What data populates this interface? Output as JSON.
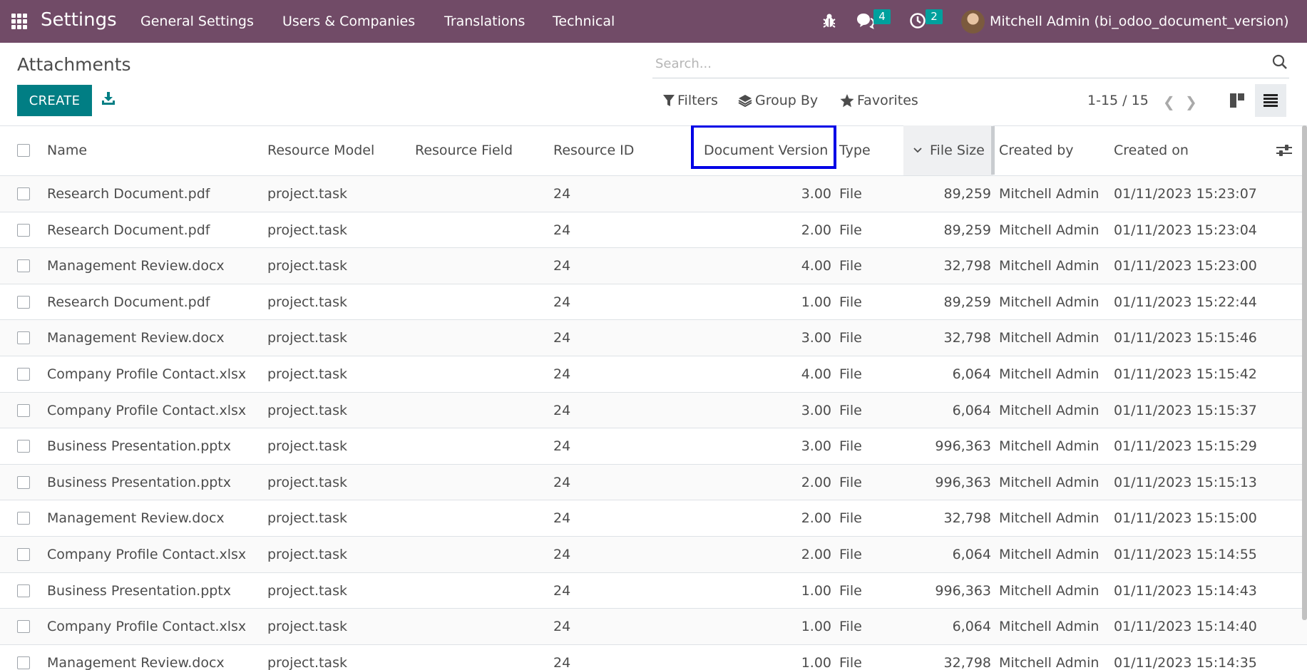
{
  "navbar": {
    "app_name": "Settings",
    "menus": [
      "General Settings",
      "Users & Companies",
      "Translations",
      "Technical"
    ],
    "messages_count": "4",
    "activities_count": "2",
    "user_name": "Mitchell Admin (bi_odoo_document_version)",
    "bg_color": "#714b67",
    "badge_color": "#00a09d"
  },
  "control_panel": {
    "title": "Attachments",
    "create_label": "CREATE",
    "search_placeholder": "Search...",
    "filters_label": "Filters",
    "group_by_label": "Group By",
    "favorites_label": "Favorites",
    "pager": "1-15 / 15",
    "accent_color": "#017e84"
  },
  "table": {
    "columns": [
      "Name",
      "Resource Model",
      "Resource Field",
      "Resource ID",
      "Document Version",
      "Type",
      "File Size",
      "Created by",
      "Created on"
    ],
    "highlighted_column": "Document Version",
    "highlight_color": "#0000e6",
    "sorted_column": "File Size",
    "rows": [
      {
        "name": "Research Document.pdf",
        "model": "project.task",
        "field": "",
        "res_id": "24",
        "version": "3.00",
        "type": "File",
        "size": "89,259",
        "created_by": "Mitchell Admin",
        "created_on": "01/11/2023 15:23:07"
      },
      {
        "name": "Research Document.pdf",
        "model": "project.task",
        "field": "",
        "res_id": "24",
        "version": "2.00",
        "type": "File",
        "size": "89,259",
        "created_by": "Mitchell Admin",
        "created_on": "01/11/2023 15:23:04"
      },
      {
        "name": "Management Review.docx",
        "model": "project.task",
        "field": "",
        "res_id": "24",
        "version": "4.00",
        "type": "File",
        "size": "32,798",
        "created_by": "Mitchell Admin",
        "created_on": "01/11/2023 15:23:00"
      },
      {
        "name": "Research Document.pdf",
        "model": "project.task",
        "field": "",
        "res_id": "24",
        "version": "1.00",
        "type": "File",
        "size": "89,259",
        "created_by": "Mitchell Admin",
        "created_on": "01/11/2023 15:22:44"
      },
      {
        "name": "Management Review.docx",
        "model": "project.task",
        "field": "",
        "res_id": "24",
        "version": "3.00",
        "type": "File",
        "size": "32,798",
        "created_by": "Mitchell Admin",
        "created_on": "01/11/2023 15:15:46"
      },
      {
        "name": "Company Profile Contact.xlsx",
        "model": "project.task",
        "field": "",
        "res_id": "24",
        "version": "4.00",
        "type": "File",
        "size": "6,064",
        "created_by": "Mitchell Admin",
        "created_on": "01/11/2023 15:15:42"
      },
      {
        "name": "Company Profile Contact.xlsx",
        "model": "project.task",
        "field": "",
        "res_id": "24",
        "version": "3.00",
        "type": "File",
        "size": "6,064",
        "created_by": "Mitchell Admin",
        "created_on": "01/11/2023 15:15:37"
      },
      {
        "name": "Business Presentation.pptx",
        "model": "project.task",
        "field": "",
        "res_id": "24",
        "version": "3.00",
        "type": "File",
        "size": "996,363",
        "created_by": "Mitchell Admin",
        "created_on": "01/11/2023 15:15:29"
      },
      {
        "name": "Business Presentation.pptx",
        "model": "project.task",
        "field": "",
        "res_id": "24",
        "version": "2.00",
        "type": "File",
        "size": "996,363",
        "created_by": "Mitchell Admin",
        "created_on": "01/11/2023 15:15:13"
      },
      {
        "name": "Management Review.docx",
        "model": "project.task",
        "field": "",
        "res_id": "24",
        "version": "2.00",
        "type": "File",
        "size": "32,798",
        "created_by": "Mitchell Admin",
        "created_on": "01/11/2023 15:15:00"
      },
      {
        "name": "Company Profile Contact.xlsx",
        "model": "project.task",
        "field": "",
        "res_id": "24",
        "version": "2.00",
        "type": "File",
        "size": "6,064",
        "created_by": "Mitchell Admin",
        "created_on": "01/11/2023 15:14:55"
      },
      {
        "name": "Business Presentation.pptx",
        "model": "project.task",
        "field": "",
        "res_id": "24",
        "version": "1.00",
        "type": "File",
        "size": "996,363",
        "created_by": "Mitchell Admin",
        "created_on": "01/11/2023 15:14:43"
      },
      {
        "name": "Company Profile Contact.xlsx",
        "model": "project.task",
        "field": "",
        "res_id": "24",
        "version": "1.00",
        "type": "File",
        "size": "6,064",
        "created_by": "Mitchell Admin",
        "created_on": "01/11/2023 15:14:40"
      },
      {
        "name": "Management Review.docx",
        "model": "project.task",
        "field": "",
        "res_id": "24",
        "version": "1.00",
        "type": "File",
        "size": "32,798",
        "created_by": "Mitchell Admin",
        "created_on": "01/11/2023 15:14:35"
      }
    ]
  }
}
